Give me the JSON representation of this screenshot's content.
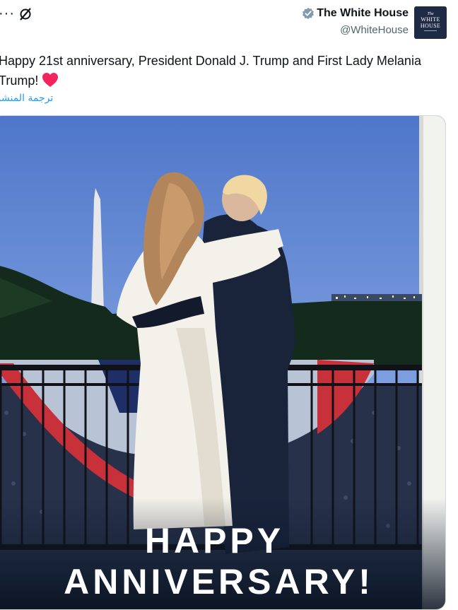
{
  "header": {
    "more_label": "···",
    "display_name": "The White House",
    "handle": "@WhiteHouse",
    "avatar": {
      "line1": "The",
      "line2": "WHITE",
      "line3": "HOUSE"
    }
  },
  "tweet": {
    "text": "Happy 21st anniversary, President Donald J. Trump and First Lady Melania Trump!",
    "translate_label": "ترجمة المنشور"
  },
  "media": {
    "overlay_line1": "HAPPY",
    "overlay_line2": "ANNIVERSARY!"
  },
  "colors": {
    "accent": "#1d9bf0",
    "verified": "#829aab",
    "heart": "#f4245e"
  }
}
